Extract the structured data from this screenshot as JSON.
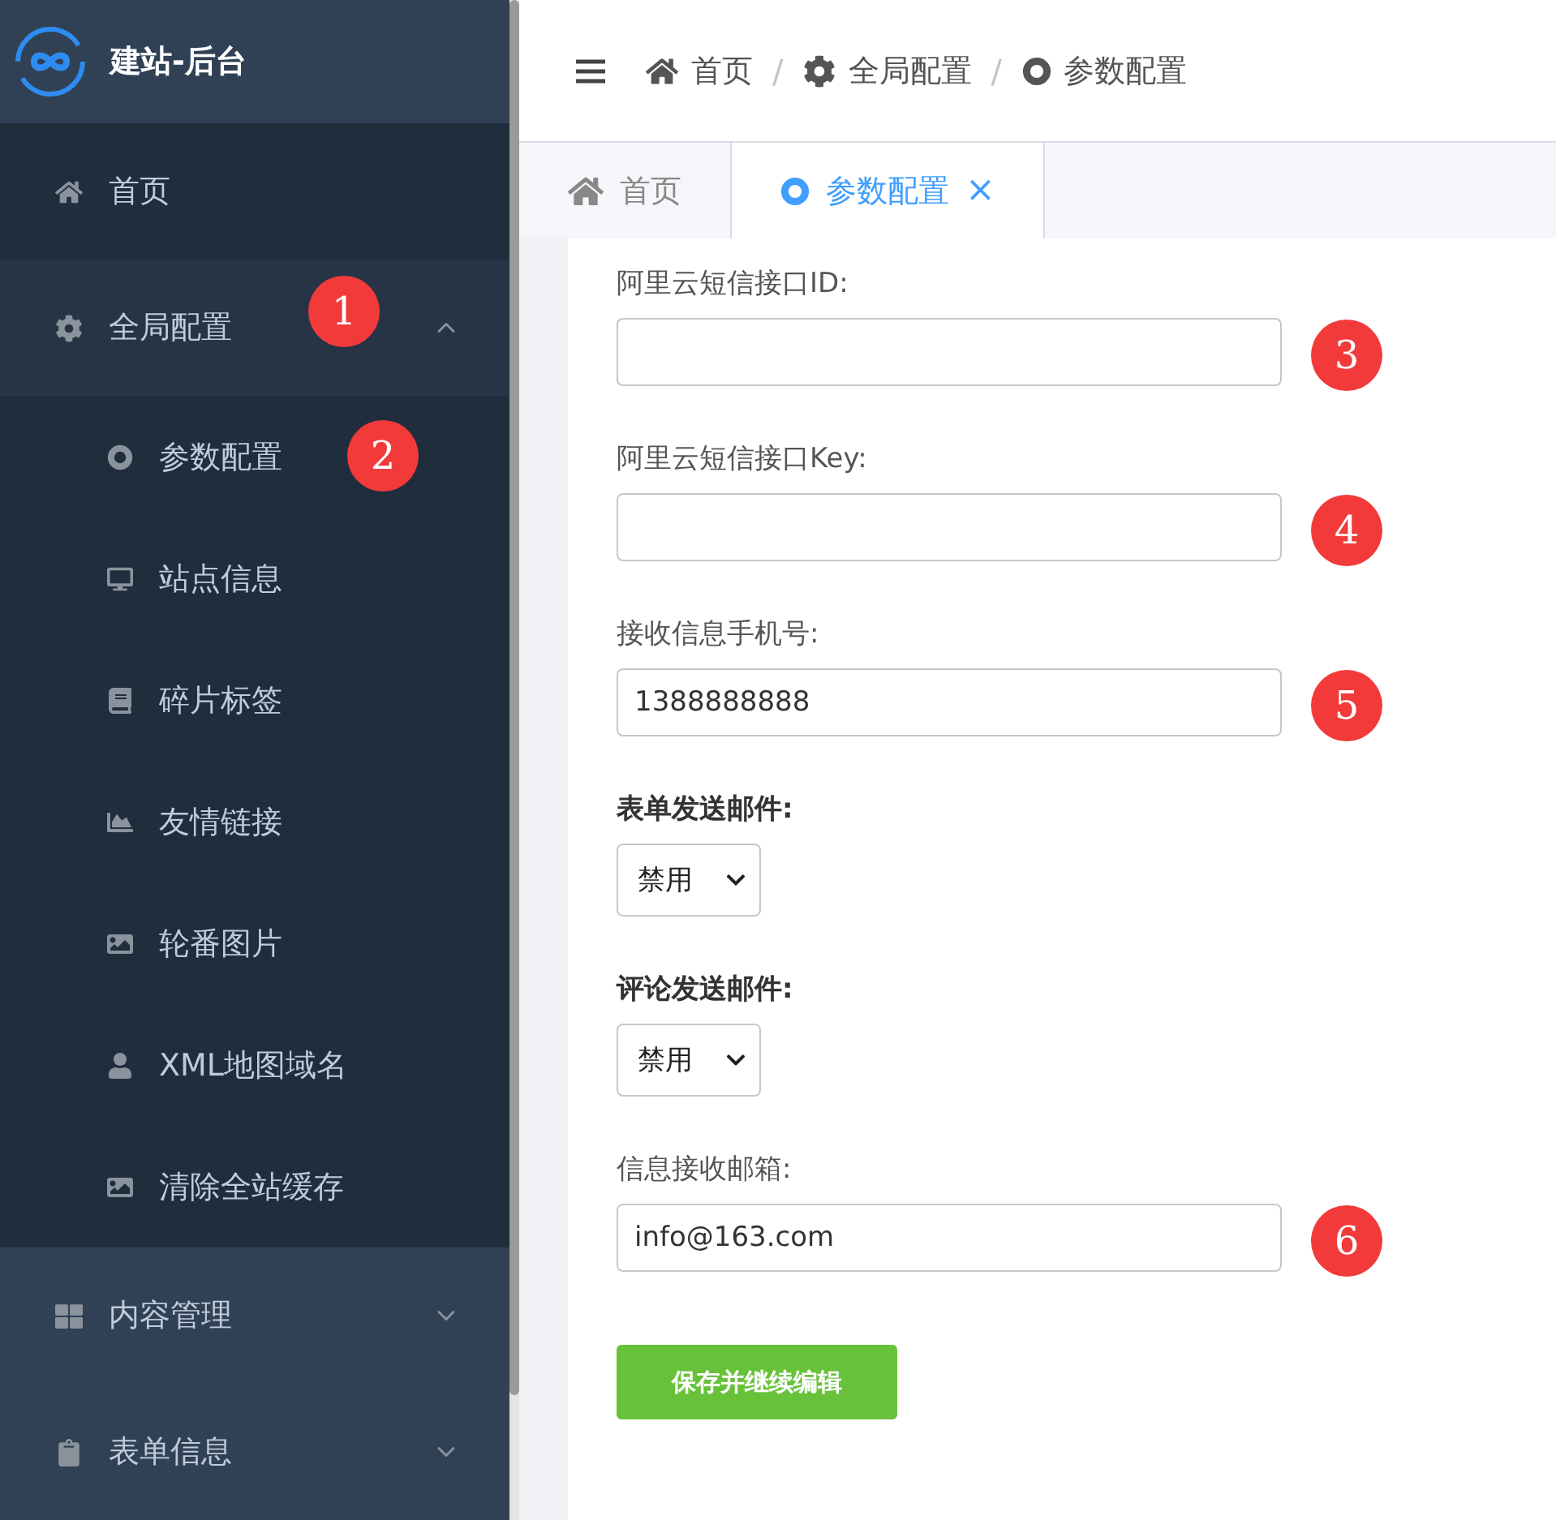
{
  "brand": {
    "title": "建站-后台"
  },
  "sidebar": {
    "items": [
      {
        "label": "首页"
      },
      {
        "label": "全局配置",
        "expanded": true,
        "badge": "1",
        "children": [
          {
            "label": "参数配置",
            "badge": "2"
          },
          {
            "label": "站点信息"
          },
          {
            "label": "碎片标签"
          },
          {
            "label": "友情链接"
          },
          {
            "label": "轮番图片"
          },
          {
            "label": "XML地图域名"
          },
          {
            "label": "清除全站缓存"
          }
        ]
      },
      {
        "label": "内容管理",
        "expanded": false
      },
      {
        "label": "表单信息",
        "expanded": false
      }
    ]
  },
  "breadcrumb": [
    {
      "label": "首页"
    },
    {
      "separator": "/",
      "label": "全局配置"
    },
    {
      "separator": "/",
      "label": "参数配置"
    }
  ],
  "tabs": [
    {
      "label": "首页",
      "selected": false
    },
    {
      "label": "参数配置",
      "selected": true,
      "close": "×"
    }
  ],
  "form": {
    "fields": [
      {
        "kind": "text",
        "label": "阿里云短信接口ID:",
        "badge": "3"
      },
      {
        "kind": "text",
        "label": "阿里云短信接口Key:",
        "badge": "4"
      },
      {
        "kind": "text",
        "label": "接收信息手机号:",
        "value": "1388888888",
        "badge": "5"
      },
      {
        "kind": "select",
        "label": "表单发送邮件:",
        "value": "禁用"
      },
      {
        "kind": "select",
        "label": "评论发送邮件:",
        "value": "禁用"
      },
      {
        "kind": "text",
        "label": "信息接收邮箱:",
        "value": "info@163.com",
        "badge": "6"
      }
    ],
    "save": "保存并继续编辑"
  }
}
